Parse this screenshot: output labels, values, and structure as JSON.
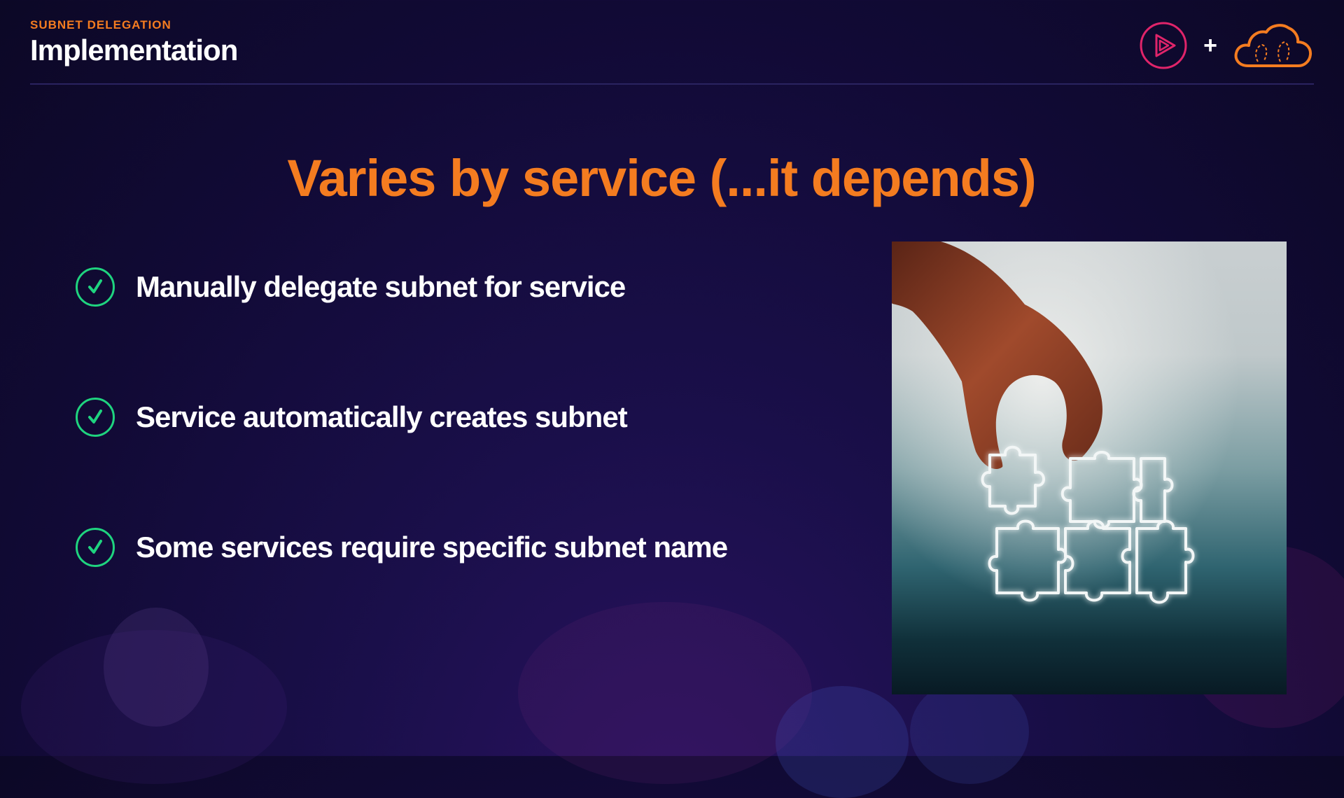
{
  "header": {
    "eyebrow": "SUBNET DELEGATION",
    "title": "Implementation"
  },
  "logos": {
    "plus": "+",
    "play_icon": "play-icon",
    "cloud_icon": "cloud-icon"
  },
  "headline": "Varies by service (...it depends)",
  "bullets": [
    {
      "text": "Manually delegate subnet for service",
      "icon": "check-icon"
    },
    {
      "text": "Service automatically creates subnet",
      "icon": "check-icon"
    },
    {
      "text": "Some services require specific subnet name",
      "icon": "check-icon"
    }
  ],
  "image": {
    "subject": "puzzle-image"
  },
  "colors": {
    "accent": "#f47c20",
    "check": "#1fd47f",
    "background": "#110a35",
    "play_logo": "#e0246a"
  }
}
